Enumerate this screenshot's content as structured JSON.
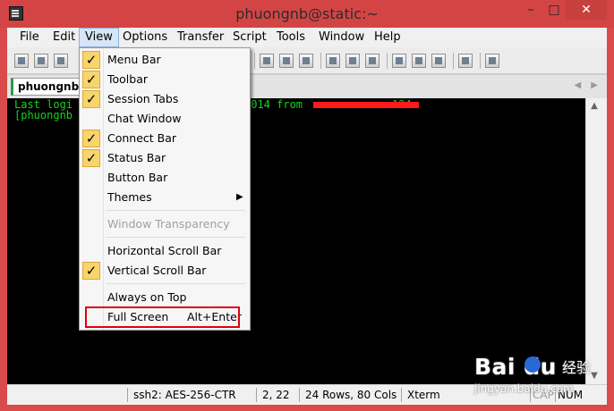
{
  "window": {
    "title": "phuongnb@static:~",
    "close_glyph": "✕",
    "minimize_glyph": "–",
    "maximize_glyph": "□"
  },
  "menubar": {
    "items": [
      "File",
      "Edit",
      "View",
      "Options",
      "Transfer",
      "Script",
      "Tools",
      "Window",
      "Help"
    ],
    "active": "View"
  },
  "toolbar": {
    "icons": [
      "connect-icon",
      "quick-connect-icon",
      "connect-tab-icon",
      "copy-icon",
      "paste-icon",
      "find-icon",
      "print-icon",
      "print-setup-icon",
      "log-icon",
      "session-options-icon",
      "keymap-icon",
      "sftp-icon",
      "help-icon",
      "sftp-browser-icon"
    ]
  },
  "tabs": {
    "session_tab": "phuongnb",
    "arrows": "◀ ▶"
  },
  "terminal": {
    "line1": "Last logi",
    "line1_suffix": "2014 from",
    "line1_tail": "124",
    "line2": "[phuongnb"
  },
  "view_menu": {
    "items": [
      {
        "label": "Menu Bar",
        "checked": true
      },
      {
        "label": "Toolbar",
        "checked": true
      },
      {
        "label": "Session Tabs",
        "checked": true
      },
      {
        "label": "Chat Window",
        "checked": false
      },
      {
        "label": "Connect Bar",
        "checked": true
      },
      {
        "label": "Status Bar",
        "checked": true
      },
      {
        "label": "Button Bar",
        "checked": false
      },
      {
        "label": "Themes",
        "checked": false,
        "submenu": true
      },
      {
        "label": "Window Transparency",
        "checked": false,
        "disabled": true
      },
      {
        "label": "Horizontal Scroll Bar",
        "checked": false
      },
      {
        "label": "Vertical Scroll Bar",
        "checked": true
      },
      {
        "label": "Always on Top",
        "checked": false
      },
      {
        "label": "Full Screen",
        "checked": false,
        "shortcut": "Alt+Enter"
      }
    ],
    "check_glyph": "✓",
    "submenu_glyph": "▶"
  },
  "statusbar": {
    "encryption": "ssh2: AES-256-CTR",
    "cursor": "2,  22",
    "size": "24 Rows, 80 Cols",
    "terminal_type": "Xterm",
    "caps": "CAP",
    "num": "NUM"
  },
  "watermark": {
    "brand": "Bai  du",
    "cn": "经验",
    "url": "jingyan.baidu.com"
  },
  "colors": {
    "titlebar": "#d34545",
    "terminal_bg": "#000000",
    "terminal_text": "#13d61a",
    "check_bg": "#f7d56b",
    "highlight_border": "#e0000f"
  }
}
